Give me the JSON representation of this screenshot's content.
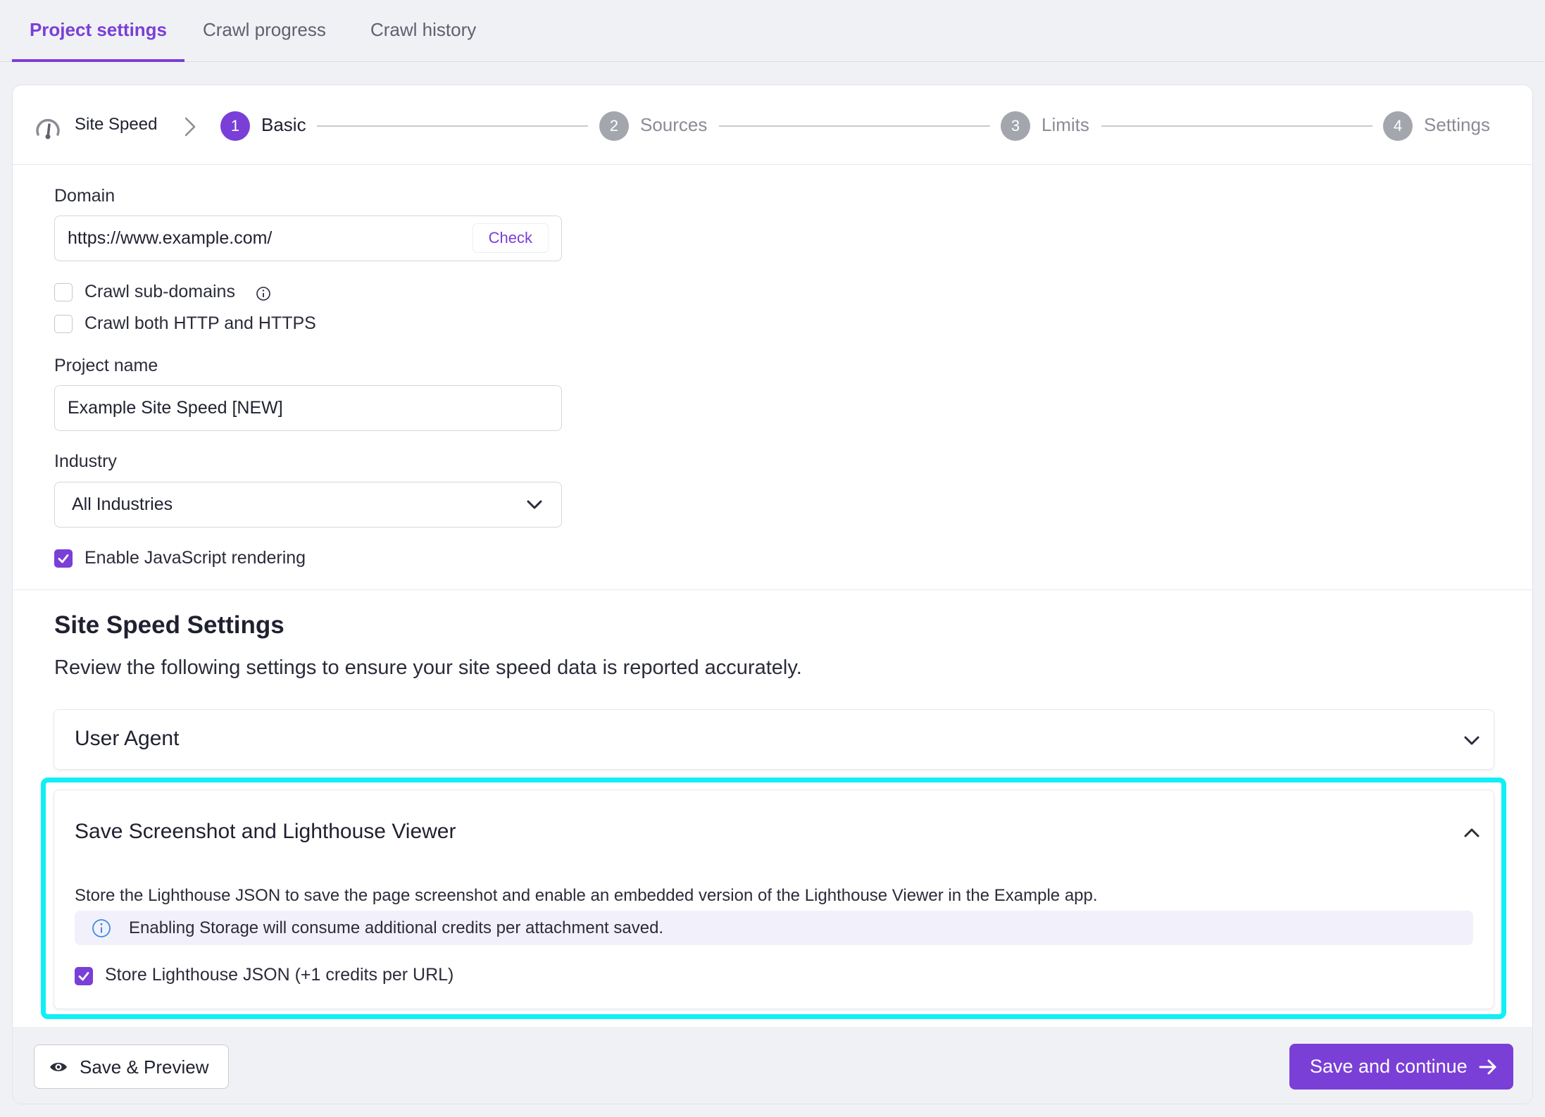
{
  "tabs": [
    {
      "label": "Project settings",
      "active": true
    },
    {
      "label": "Crawl progress",
      "active": false
    },
    {
      "label": "Crawl history",
      "active": false
    }
  ],
  "stepper": {
    "project_type": "Site Speed",
    "steps": [
      {
        "number": "1",
        "label": "Basic",
        "active": true
      },
      {
        "number": "2",
        "label": "Sources",
        "active": false
      },
      {
        "number": "3",
        "label": "Limits",
        "active": false
      },
      {
        "number": "4",
        "label": "Settings",
        "active": false
      }
    ]
  },
  "form": {
    "domain_label": "Domain",
    "domain_value": "https://www.example.com/",
    "check_label": "Check",
    "crawl_subdomains_label": "Crawl sub-domains",
    "crawl_subdomains_checked": false,
    "crawl_both_label": "Crawl both HTTP and HTTPS",
    "crawl_both_checked": false,
    "project_name_label": "Project name",
    "project_name_value": "Example Site Speed [NEW]",
    "industry_label": "Industry",
    "industry_value": "All Industries",
    "js_rendering_label": "Enable JavaScript rendering",
    "js_rendering_checked": true
  },
  "site_speed": {
    "heading": "Site Speed Settings",
    "description": "Review the following settings to ensure your site speed data is reported accurately.",
    "user_agent_title": "User Agent",
    "lighthouse_title": "Save Screenshot and Lighthouse Viewer",
    "lighthouse_description": "Store the Lighthouse JSON to save the page screenshot and enable an embedded version of the Lighthouse Viewer in the Example app.",
    "notice_text": "Enabling Storage will consume additional credits per attachment saved.",
    "store_json_label": "Store Lighthouse JSON (+1 credits per URL)",
    "store_json_checked": true
  },
  "footer": {
    "preview_label": "Save & Preview",
    "continue_label": "Save and continue"
  },
  "colors": {
    "accent": "#7a3fd6",
    "highlight": "#12eef6",
    "notice_bg": "#f2f1fb"
  },
  "icons": [
    "gauge-icon",
    "chevron-right-icon",
    "info-icon",
    "chevron-down-icon",
    "chevron-up-icon",
    "check-icon",
    "eye-icon",
    "arrow-right-icon"
  ]
}
